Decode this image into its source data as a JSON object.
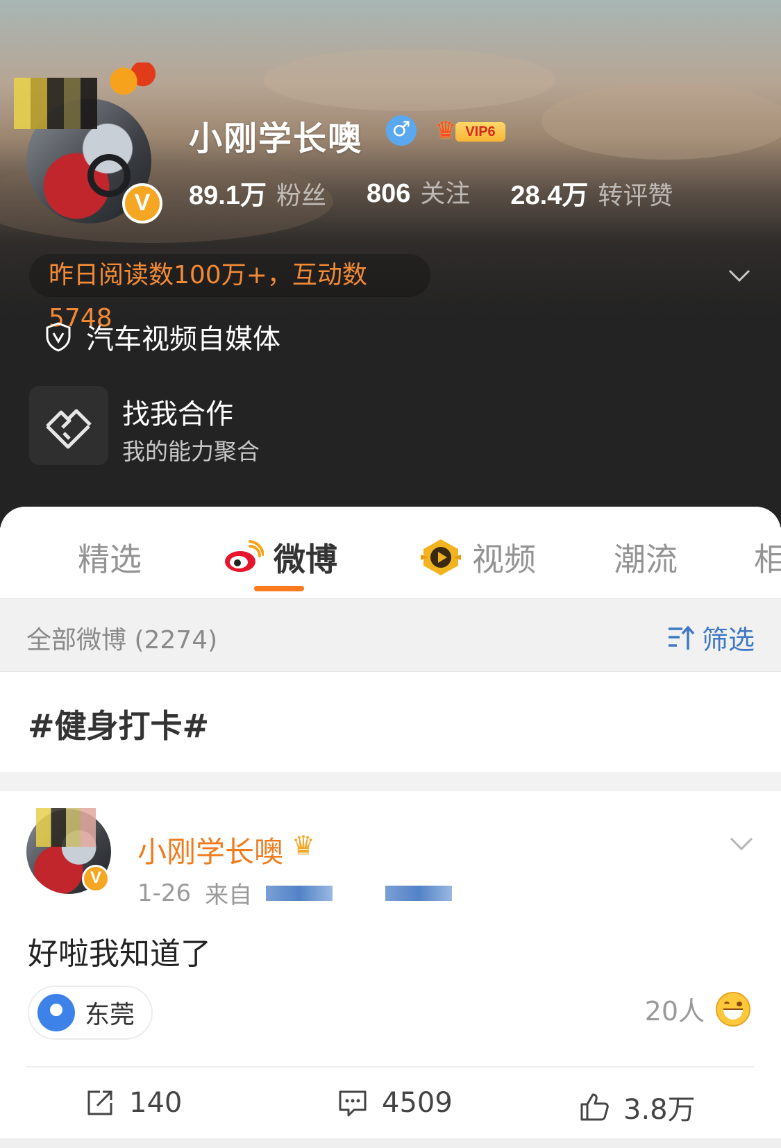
{
  "profile": {
    "name": "小刚学长噢",
    "gender_symbol": "♂",
    "vip_label": "VIP6",
    "verify_mark": "V",
    "stats": [
      {
        "value": "89.1万",
        "label": "粉丝"
      },
      {
        "value": "806",
        "label": "关注"
      },
      {
        "value": "28.4万",
        "label": "转评赞"
      }
    ],
    "reading_summary": "昨日阅读数100万+，互动数5748",
    "verified_tag": "汽车视频自媒体",
    "cooperation": {
      "title": "找我合作",
      "subtitle": "我的能力聚合"
    }
  },
  "tabs": [
    {
      "label": "精选",
      "active": false
    },
    {
      "label": "微博",
      "active": true,
      "icon": "weibo-logo-icon"
    },
    {
      "label": "视频",
      "active": false,
      "icon": "video-play-icon"
    },
    {
      "label": "潮流",
      "active": false
    },
    {
      "label": "相",
      "active": false
    }
  ],
  "filter": {
    "all_posts": "全部微博 (2274)",
    "filter_label": "筛选"
  },
  "topic": "#健身打卡#",
  "post": {
    "author": "小刚学长噢",
    "date": "1-26",
    "source_prefix": "来自",
    "text": "好啦我知道了",
    "location": "东莞",
    "reactors": "20人",
    "reposts": "140",
    "comments": "4509",
    "likes": "3.8万"
  },
  "colors": {
    "accent_orange": "#f97b1d",
    "link_blue": "#3f78c4",
    "verify_gold": "#f5a623",
    "header_dark": "#232323"
  }
}
